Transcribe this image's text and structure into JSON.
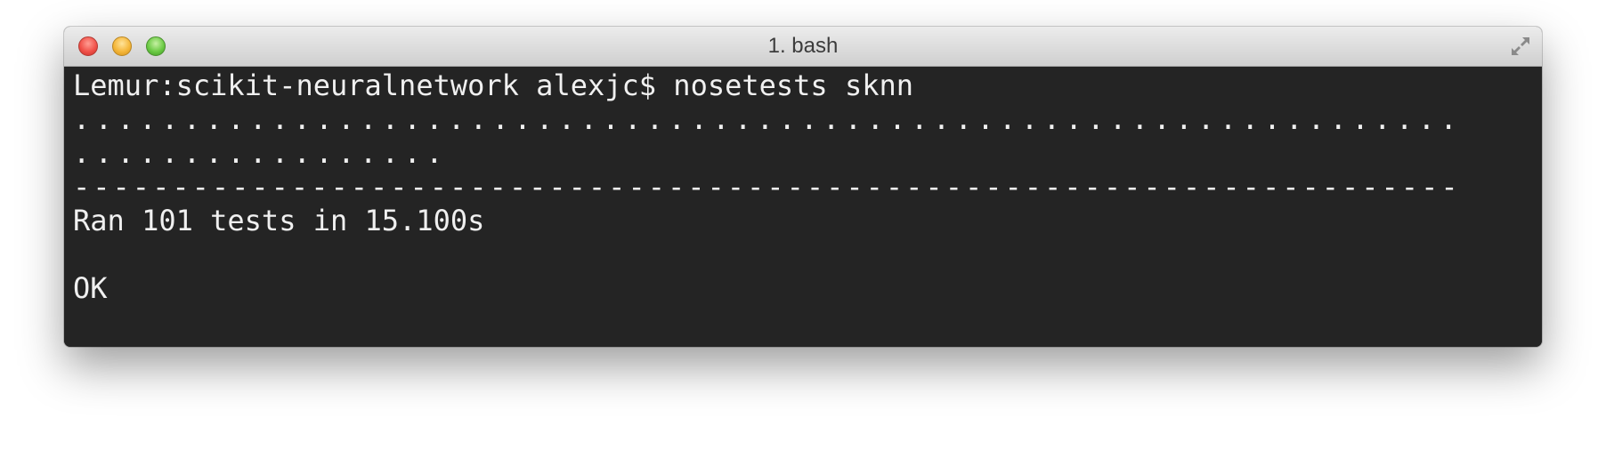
{
  "window": {
    "title": "1. bash"
  },
  "terminal": {
    "prompt": "Lemur:scikit-neuralnetwork alexjc$ nosetests sknn",
    "dots_line_1": "...............................................................",
    "dots_line_2": ".................",
    "separator": "----------------------------------------------------------------------",
    "summary": "Ran 101 tests in 15.100s",
    "blank": "",
    "result": "OK"
  },
  "colors": {
    "terminal_bg": "#242424",
    "terminal_fg": "#f0f0f0",
    "close": "#f1524a",
    "minimize": "#f5b73a",
    "zoom": "#6ccb45"
  },
  "icons": {
    "close": "close-traffic-light",
    "minimize": "minimize-traffic-light",
    "zoom": "zoom-traffic-light",
    "fullscreen": "fullscreen-arrows-icon"
  }
}
